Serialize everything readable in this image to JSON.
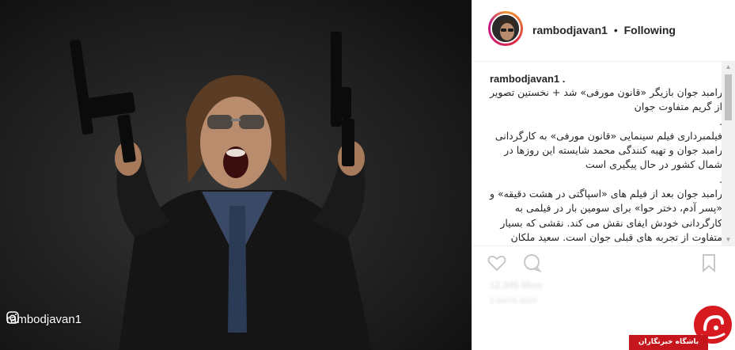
{
  "post": {
    "username": "rambodjavan1",
    "separator": "•",
    "follow_status": "Following"
  },
  "photo": {
    "watermark_text": "rambodjavan1"
  },
  "caption": {
    "username": "rambodjavan1 .",
    "lines": [
      "رامبد جوان بازیگر «قانون مورفی» شد + نخستین تصویر",
      "از گریم متفاوت جوان",
      ".",
      "فیلمبرداری فیلم سینمایی «قانون مورفی» به کارگردانی",
      "رامبد جوان و تهیه کنندگی محمد شایسته این روزها در",
      "شمال کشور در حال پیگیری است",
      ".",
      "رامبد جوان بعد از فیلم های «اسپاگتی در هشت دقیقه» و",
      "«پسر آدم، دختر حوا» برای سومین بار در فیلمی به",
      "کارگردانی خودش ایفای نقش می کند. نقشی که بسیار",
      "متفاوت از تجربه های قبلی جوان است. سعید ملکان"
    ]
  },
  "actions": {
    "likes_text": "12,345 likes",
    "time_text": "2 DAYS AGO"
  },
  "site_logo": {
    "banner_text": "باشگاه خبرنگاران"
  },
  "icons": {
    "instagram": "instagram-icon",
    "like": "heart-icon",
    "comment": "comment-icon",
    "save": "bookmark-icon",
    "scroll_up": "scroll-up-arrow-icon",
    "scroll_down": "scroll-down-arrow-icon"
  },
  "colors": {
    "text": "#262626",
    "border": "#efefef",
    "logo_red": "#d71920"
  }
}
